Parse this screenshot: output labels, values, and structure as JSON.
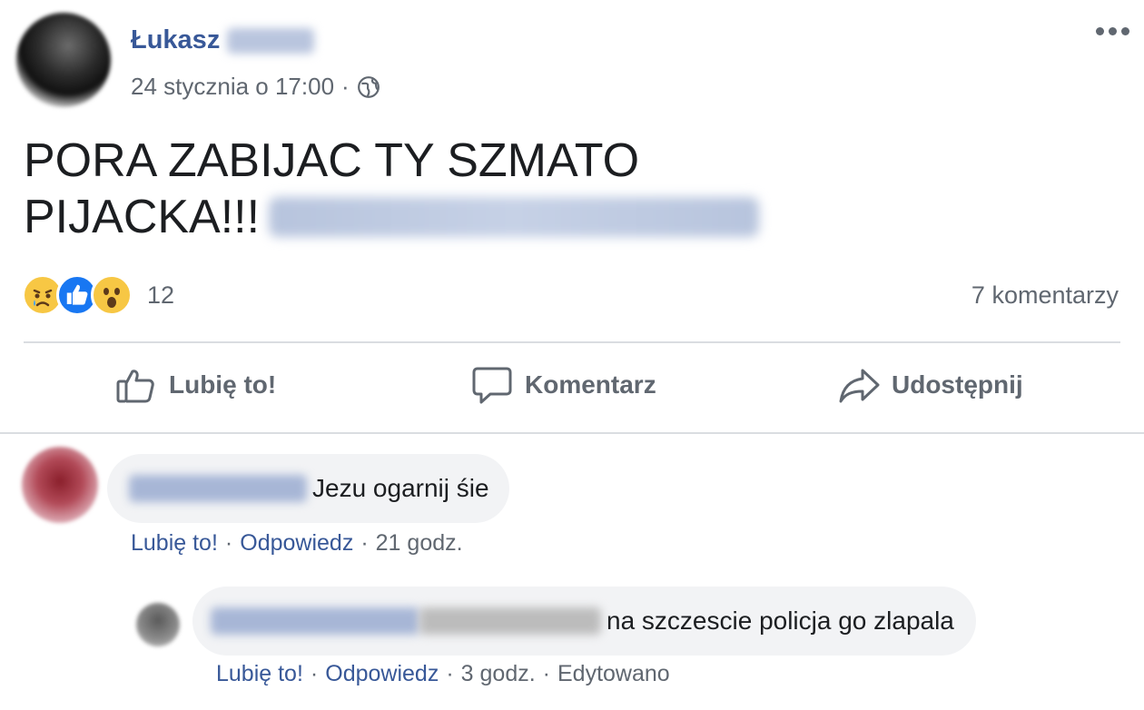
{
  "post": {
    "author_first_name": "Łukasz",
    "timestamp": "24 stycznia o 17:00",
    "meta_separator": "·",
    "text_line1": "PORA ZABIJAC TY SZMATO",
    "text_line2": "PIJACKA!!!",
    "reactions_count": "12",
    "comments_count": "7 komentarzy",
    "icons": [
      "globe-icon",
      "more-options-icon",
      "sad-reaction-icon",
      "like-reaction-icon",
      "wow-reaction-icon"
    ]
  },
  "actions": {
    "like_label": "Lubię to!",
    "comment_label": "Komentarz",
    "share_label": "Udostępnij"
  },
  "comments": [
    {
      "text": "Jezu ogarnij śie",
      "like_label": "Lubię to!",
      "reply_label": "Odpowiedz",
      "time": "21 godz.",
      "separator": "·"
    },
    {
      "text": "na szczescie policja go zlapala",
      "like_label": "Lubię to!",
      "reply_label": "Odpowiedz",
      "time": "3 godz.",
      "edited_label": "Edytowano",
      "separator": "·"
    }
  ],
  "colors": {
    "link_blue": "#385898",
    "secondary_text": "#606770",
    "bubble_bg": "#f2f3f5",
    "divider": "#dadde1",
    "like_blue": "#1877f2"
  }
}
